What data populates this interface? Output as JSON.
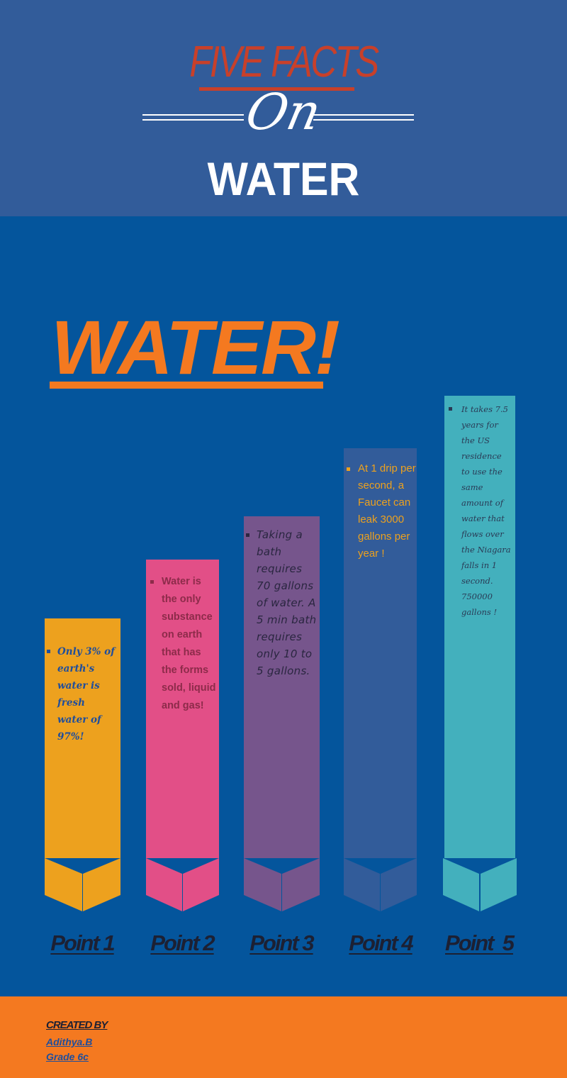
{
  "header": {
    "top_title": "FIVE FACTS",
    "connector": "On",
    "main_title": "WATER"
  },
  "hero": {
    "title": "WATER!"
  },
  "facts": [
    {
      "label": "Point 1",
      "text": "Only 3% of earth's water is fresh water of 97%!",
      "color": "#eda11e",
      "text_color": "#1f4e9c",
      "level": 0.48
    },
    {
      "label": "Point 2",
      "text": "Water is the only substance on earth that has the forms sold, liquid and gas!",
      "color": "#e24f87",
      "text_color": "#8d2b4a",
      "level": 0.6
    },
    {
      "label": "Point 3",
      "text": "Taking a bath requires 70 gallons of water. A 5 min bath requires only 10 to 5 gallons.",
      "color": "#76558c",
      "text_color": "#2a2640",
      "level": 0.72
    },
    {
      "label": "Point 4",
      "text": "At 1 drip per second, a Faucet can leak 3000 gallons per year !",
      "color": "#325c9a",
      "text_color": "#eda11e",
      "level": 0.91
    },
    {
      "label": "Point  5",
      "text": "It takes 7.5 years for the US residence to use the same amount of water that flows over the Niagara falls in 1 second. 750000 gallons !",
      "color": "#43b0bd",
      "text_color": "#2a3a55",
      "level": 1.0
    }
  ],
  "footer": {
    "created_by": "CREATED BY",
    "author": "Adithya.B",
    "grade": "Grade 6c"
  }
}
